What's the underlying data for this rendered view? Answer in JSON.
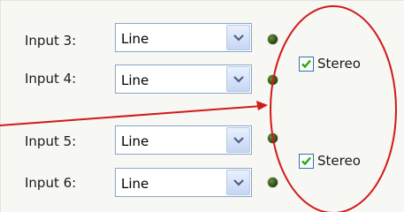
{
  "inputs": [
    {
      "label": "Input 3:",
      "value": "Line"
    },
    {
      "label": "Input 4:",
      "value": "Line"
    },
    {
      "label": "Input 5:",
      "value": "Line"
    },
    {
      "label": "Input 6:",
      "value": "Line"
    }
  ],
  "stereo": [
    {
      "label": "Stereo",
      "checked": true
    },
    {
      "label": "Stereo",
      "checked": true
    }
  ],
  "icons": {
    "dropdown": "chevron-down-icon",
    "indicator": "status-led-icon",
    "check": "checkmark-icon"
  },
  "colors": {
    "annotation": "#d11a1a",
    "check": "#27a61b",
    "led": "#2e4f12"
  }
}
